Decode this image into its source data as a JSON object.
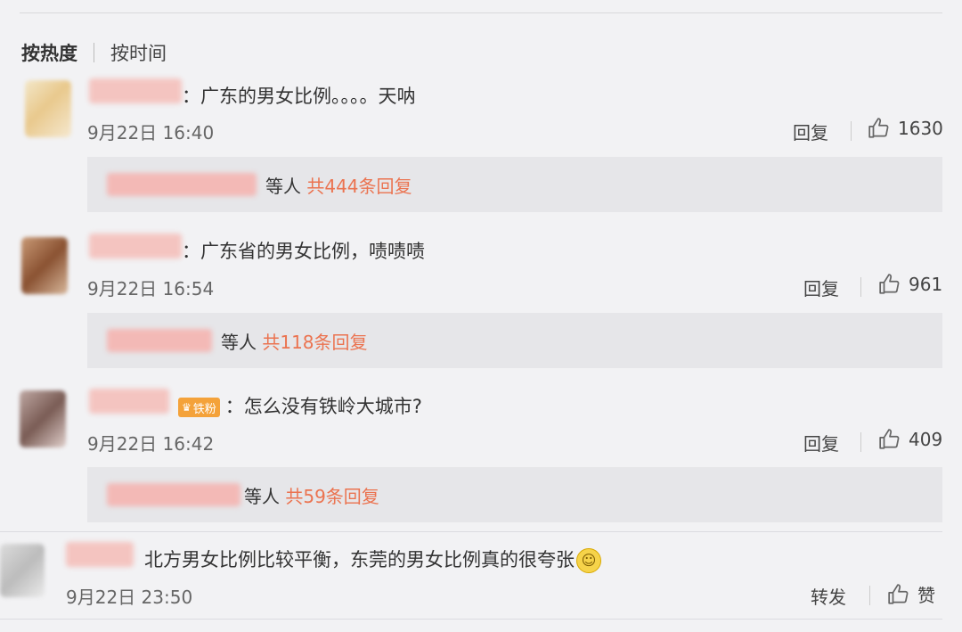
{
  "sort": {
    "selected": "按热度",
    "other": "按时间"
  },
  "comments": [
    {
      "text": "：广东的男女比例。。。。天呐",
      "time": "9月22日 16:40",
      "reply_label": "回复",
      "likes": "1630",
      "replies": {
        "who": "等人",
        "count": "共444条回复"
      }
    },
    {
      "text": "：广东省的男女比例，啧啧啧",
      "time": "9月22日 16:54",
      "reply_label": "回复",
      "likes": "961",
      "replies": {
        "who": "等人",
        "count": "共118条回复"
      }
    },
    {
      "badge": "铁粉",
      "text": "：怎么没有铁岭大城市?",
      "time": "9月22日 16:42",
      "reply_label": "回复",
      "likes": "409",
      "replies": {
        "who": "等人",
        "count": "共59条回复"
      }
    }
  ],
  "repost": {
    "text": "北方男女比例比较平衡，东莞的男女比例真的很夸张",
    "time": "9月22日 23:50",
    "forward_label": "转发",
    "like_label": "赞"
  },
  "colors": {
    "link": "#eb7350",
    "background": "#f2f2f4",
    "reply_box": "#e6e6e9"
  },
  "icons": {
    "like": "thumbs-up-icon",
    "emoji": "smile-emoji-icon",
    "badge": "crown-icon"
  }
}
